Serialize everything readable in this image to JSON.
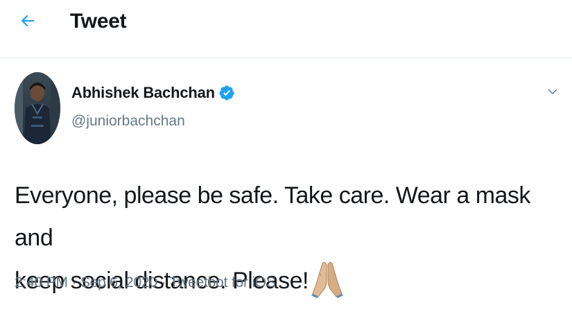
{
  "header": {
    "back_icon": "arrow-left-icon",
    "title": "Tweet"
  },
  "colors": {
    "accent": "#1da1f2",
    "text_primary": "#14171a",
    "text_secondary": "#657786",
    "divider": "#e6ecf0"
  },
  "tweet": {
    "author": {
      "name": "Abhishek Bachchan",
      "handle": "@juniorbachchan",
      "verified": true,
      "verified_icon": "verified-badge-icon",
      "avatar_icon": "avatar"
    },
    "more_icon": "chevron-down-icon",
    "text_line1": "Everyone, please be safe. Take care. Wear a mask and",
    "text_line2": "keep social distance. Please!",
    "emoji": "folded-hands-emoji",
    "time": "2:40 PM",
    "sep": " · ",
    "date": "Sep 6, 2020",
    "source": "Tweetbot for iOS"
  }
}
